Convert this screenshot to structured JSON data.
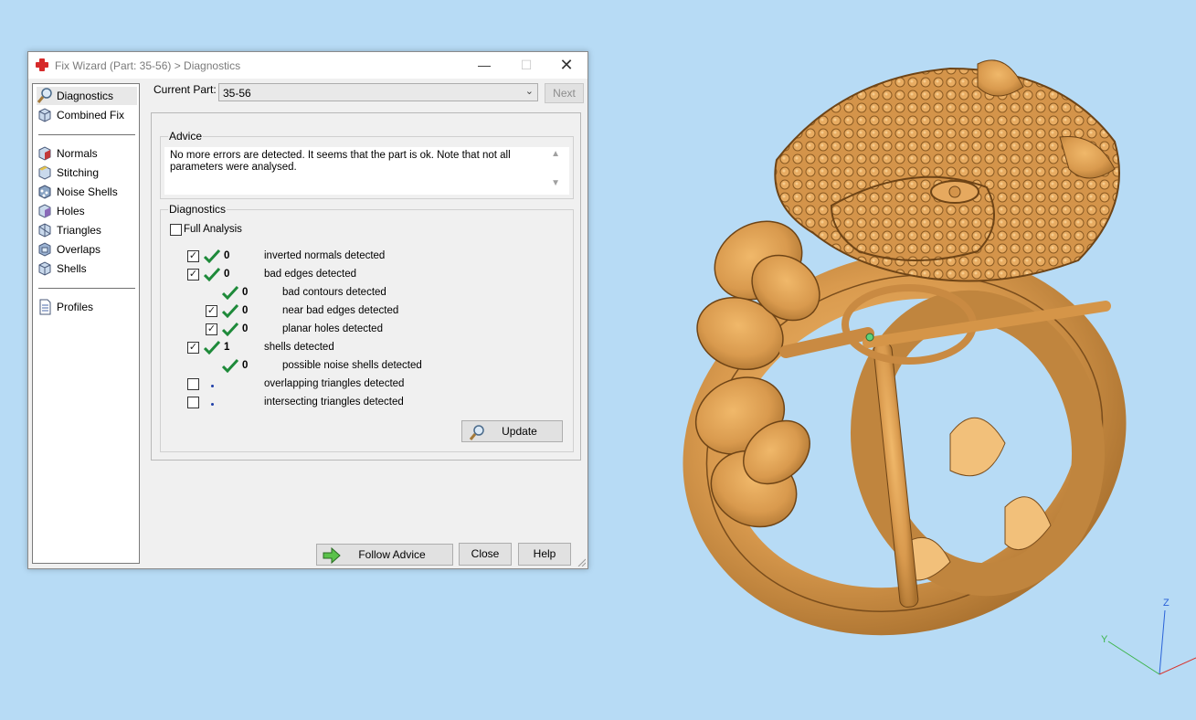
{
  "window": {
    "title": "Fix Wizard (Part: 35-56) > Diagnostics",
    "minimize_glyph": "—",
    "maximize_glyph": "☐",
    "close_glyph": "✕"
  },
  "nav": {
    "items": [
      {
        "label": "Diagnostics",
        "icon": "magnifier-icon",
        "selected": true
      },
      {
        "label": "Combined Fix",
        "icon": "cube-icon"
      },
      {
        "label": "Normals",
        "icon": "normals-cube-icon"
      },
      {
        "label": "Stitching",
        "icon": "stitching-cube-icon"
      },
      {
        "label": "Noise Shells",
        "icon": "noise-shells-icon"
      },
      {
        "label": "Holes",
        "icon": "holes-cube-icon"
      },
      {
        "label": "Triangles",
        "icon": "triangles-cube-icon"
      },
      {
        "label": "Overlaps",
        "icon": "overlaps-cube-icon"
      },
      {
        "label": "Shells",
        "icon": "shells-cube-icon"
      },
      {
        "label": "Profiles",
        "icon": "document-icon"
      }
    ]
  },
  "part": {
    "label": "Current Part:",
    "value": "35-56",
    "next_label": "Next"
  },
  "advice": {
    "title": "Advice",
    "text": "No more errors are detected. It seems that the part is ok. Note that not all parameters were analysed."
  },
  "diagnostics": {
    "title": "Diagnostics",
    "full_analysis_label": "Full Analysis",
    "rows": [
      {
        "checked": true,
        "status": "ok",
        "count": "0",
        "label": "inverted normals detected"
      },
      {
        "checked": true,
        "status": "ok",
        "count": "0",
        "label": "bad edges detected"
      },
      {
        "status": "ok",
        "count": "0",
        "label": "bad contours detected"
      },
      {
        "checked": true,
        "status": "ok",
        "count": "0",
        "label": "near bad edges detected"
      },
      {
        "checked": true,
        "status": "ok",
        "count": "0",
        "label": "planar holes detected"
      },
      {
        "checked": true,
        "status": "ok",
        "count": "1",
        "label": "shells detected"
      },
      {
        "status": "ok",
        "count": "0",
        "label": "possible noise shells detected"
      },
      {
        "checked": false,
        "status": "unknown",
        "count": "",
        "label": "overlapping triangles detected"
      },
      {
        "checked": false,
        "status": "unknown",
        "count": "",
        "label": "intersecting triangles detected"
      }
    ],
    "update_label": "Update"
  },
  "buttons": {
    "follow_advice": "Follow Advice",
    "close": "Close",
    "help": "Help"
  },
  "viewport": {
    "axes": {
      "z": "Z",
      "y": "Y"
    },
    "model_color": "#d99a4e",
    "background": "#b7dbf5"
  }
}
